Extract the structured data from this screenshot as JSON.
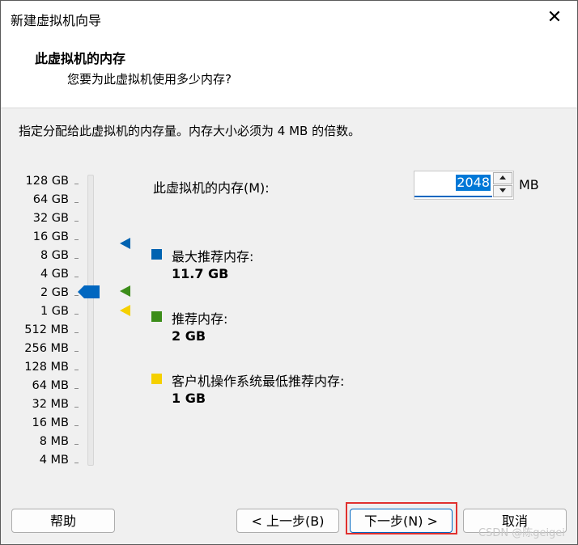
{
  "window": {
    "title": "新建虚拟机向导",
    "close_glyph": "✕"
  },
  "header": {
    "title": "此虚拟机的内存",
    "subtitle": "您要为此虚拟机使用多少内存?"
  },
  "instructions": "指定分配给此虚拟机的内存量。内存大小必须为 4 MB 的倍数。",
  "scale": [
    "128 GB",
    "64 GB",
    "32 GB",
    "16 GB",
    "8 GB",
    "4 GB",
    "2 GB",
    "1 GB",
    "512 MB",
    "256 MB",
    "128 MB",
    "64 MB",
    "32 MB",
    "16 MB",
    "8 MB",
    "4 MB"
  ],
  "slider": {
    "selected": "2 GB"
  },
  "memory": {
    "label": "此虚拟机的内存(M):",
    "value": "2048",
    "unit": "MB"
  },
  "legend": [
    {
      "label": "最大推荐内存:",
      "value": "11.7 GB",
      "color": "#0063b1",
      "marker_at": "16 GB"
    },
    {
      "label": "推荐内存:",
      "value": "2 GB",
      "color": "#3c8d1a",
      "marker_at": "2 GB"
    },
    {
      "label": "客户机操作系统最低推荐内存:",
      "value": "1 GB",
      "color": "#f5d000",
      "marker_at": "1 GB"
    }
  ],
  "buttons": {
    "help": "帮助",
    "back": "< 上一步(B)",
    "next": "下一步(N) >",
    "cancel": "取消"
  },
  "watermark": "CSDN @陈geigei"
}
